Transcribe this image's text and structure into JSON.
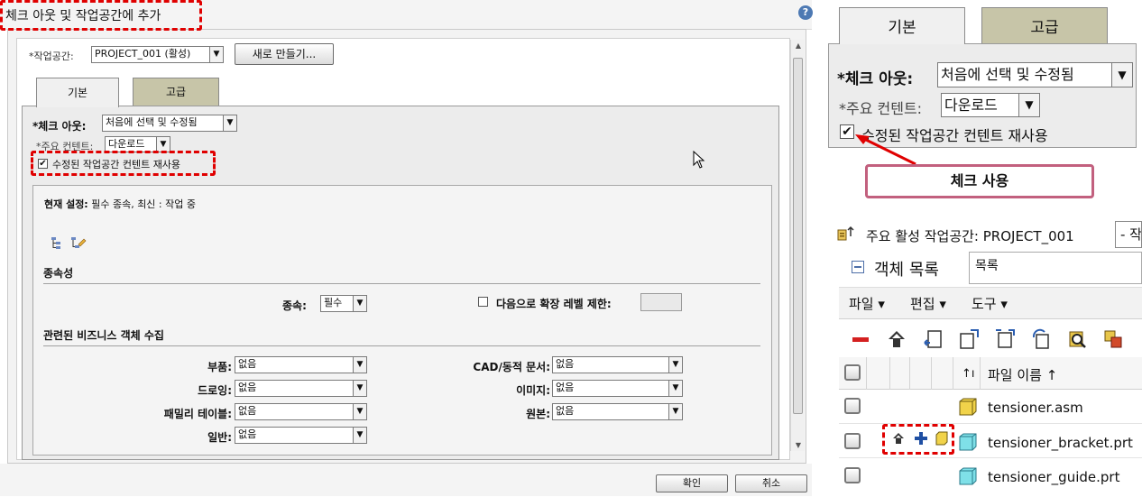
{
  "dialog": {
    "title": "체크 아웃 및 작업공간에 추가",
    "workspace_label": "*작업공간:",
    "workspace_value": "PROJECT_001 (활성)",
    "new_button": "새로 만들기...",
    "tabs": [
      "기본",
      "고급"
    ],
    "checkout_label": "*체크 아웃:",
    "checkout_value": "처음에 선택 및 수정됨",
    "primary_content_label": "*주요 컨텐트:",
    "primary_content_value": "다운로드",
    "reuse_label": "수정된 작업공간 컨텐트 재사용",
    "current_settings_label": "현재 설정:",
    "current_settings_value": "필수 종속, 최신 : 작업 중",
    "dependency_section": "종속성",
    "dependency_label": "종속:",
    "dependency_value": "필수",
    "limit_label": "다음으로 확장 레벨 제한:",
    "collect_section": "관련된 비즈니스 객체 수집",
    "fields": {
      "parts_label": "부품:",
      "parts_value": "없음",
      "drawing_label": "드로잉:",
      "drawing_value": "없음",
      "family_label": "패밀리 테이블:",
      "family_value": "없음",
      "general_label": "일반:",
      "general_value": "없음",
      "cad_label": "CAD/동적 문서:",
      "cad_value": "없음",
      "image_label": "이미지:",
      "image_value": "없음",
      "original_label": "원본:",
      "original_value": "없음"
    },
    "ok_button": "확인",
    "cancel_button": "취소",
    "help_icon_glyph": "?"
  },
  "zoom": {
    "tabs": [
      "기본",
      "고급"
    ],
    "checkout_label": "*체크 아웃:",
    "checkout_value": "처음에 선택 및 수정됨",
    "primary_content_label": "*주요 컨텐트:",
    "primary_content_value": "다운로드",
    "reuse_label": "수정된 작업공간 컨텐트 재사용"
  },
  "callout": {
    "text": "체크 사용"
  },
  "workspace_panel": {
    "active_label": "주요 활성 작업공간: PROJECT_001",
    "active_select": "- 작",
    "object_list_label": "객체 목록",
    "object_list_value": "목록",
    "menu": [
      "파일 ▾",
      "편집 ▾",
      "도구 ▾"
    ],
    "column_header": "파일 이름 ↑",
    "files": [
      "tensioner.asm",
      "tensioner_bracket.prt",
      "tensioner_guide.prt"
    ]
  },
  "colors": {
    "accent_red": "#e00000",
    "tab_inactive": "#c7c5a8",
    "panel_bg": "#e8e8e8",
    "callout_border": "#c2607e"
  }
}
